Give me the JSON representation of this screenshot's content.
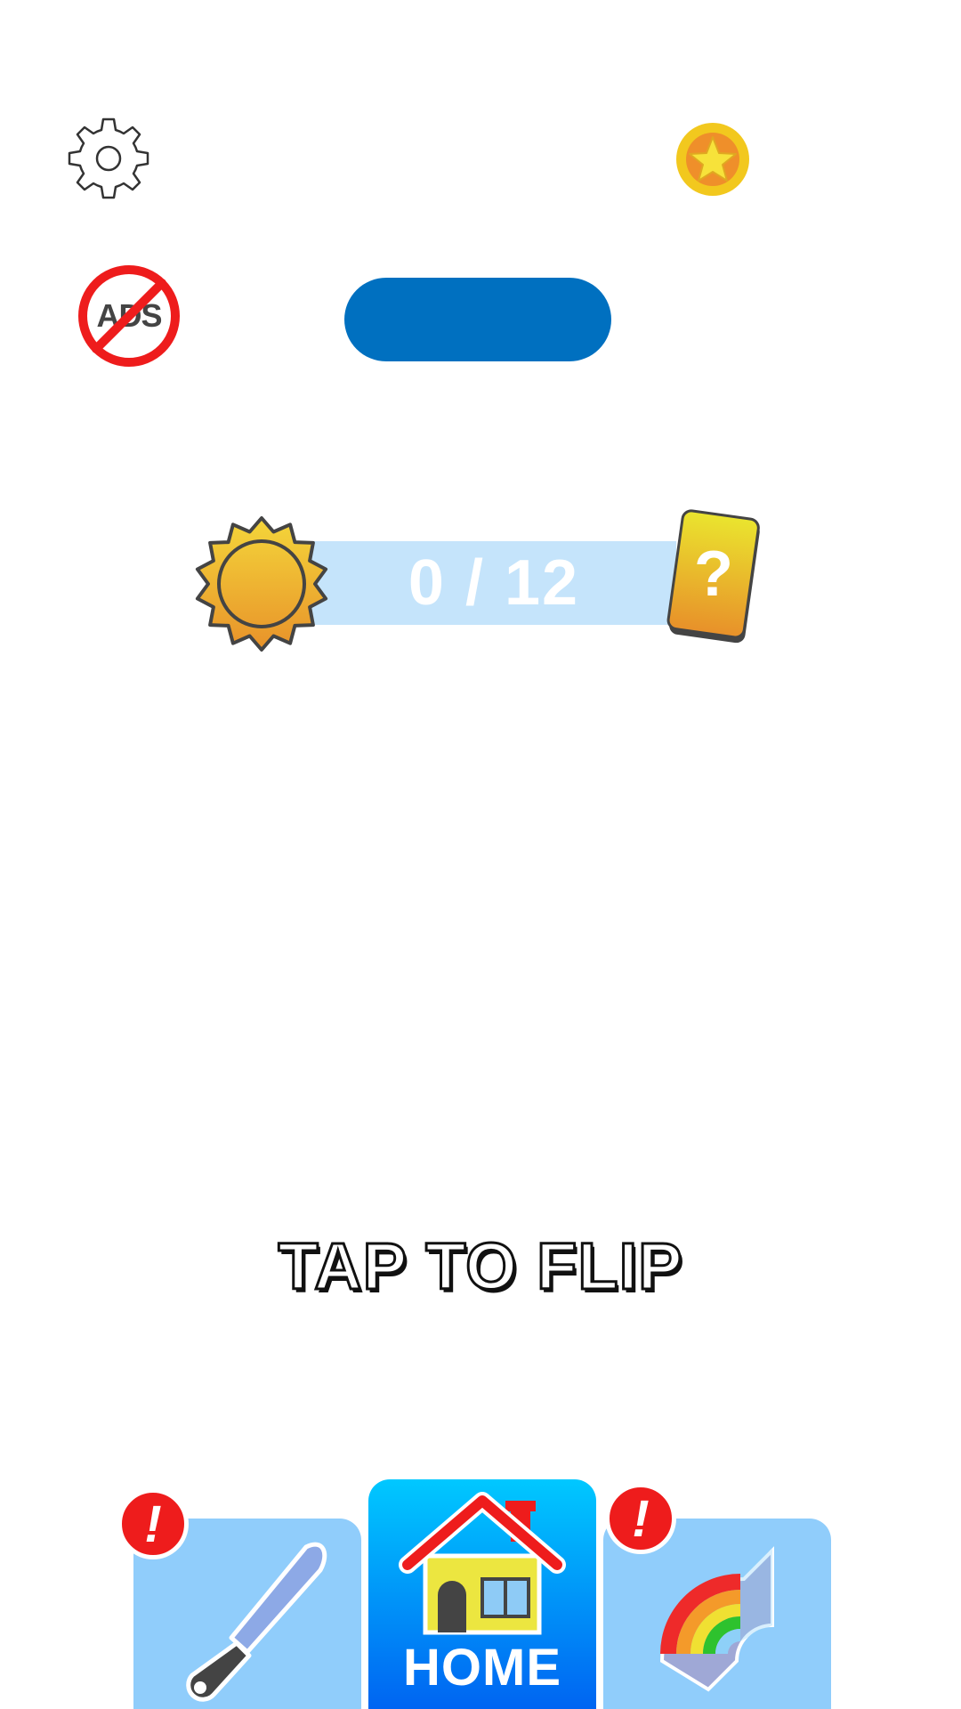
{
  "top_bar": {
    "settings_icon": "gear-icon",
    "coin_icon": "star-coin-icon"
  },
  "no_ads": {
    "label": "ADS",
    "icon": "no-ads-icon"
  },
  "level_pill": {
    "color": "#0070c0"
  },
  "progress": {
    "text": "0 / 12",
    "current": 0,
    "total": 12,
    "start_icon": "sun-icon",
    "reward_icon": "mystery-card-icon",
    "reward_symbol": "?",
    "track_color": "#c5e4fb"
  },
  "prompt": {
    "text": "TAP TO FLIP"
  },
  "bottom_nav": {
    "tabs": [
      {
        "id": "knife",
        "icon": "knife-icon",
        "alert": "!"
      },
      {
        "id": "home",
        "icon": "house-icon",
        "label": "HOME",
        "selected": true
      },
      {
        "id": "rainbow",
        "icon": "rainbow-icon",
        "alert": "!"
      }
    ]
  },
  "colors": {
    "tab_bg": "#90cdfb",
    "tab_selected_top": "#00c8ff",
    "tab_selected_bottom": "#0058f0",
    "alert": "#ee1c1c",
    "coin": "#f2c81e"
  }
}
